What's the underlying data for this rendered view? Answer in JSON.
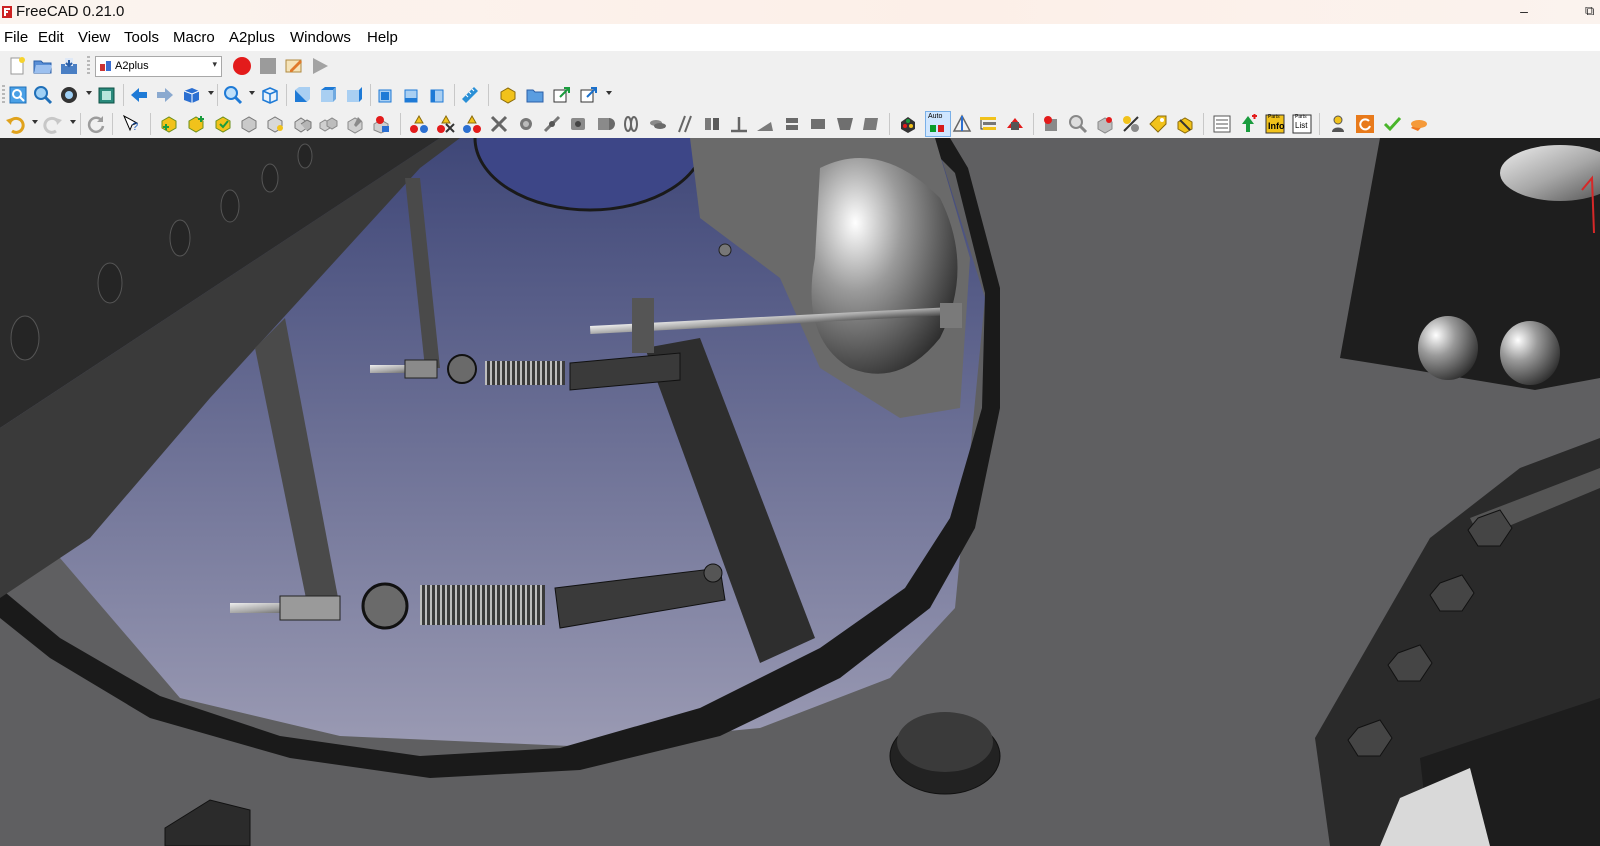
{
  "window": {
    "title": "FreeCAD 0.21.0",
    "minimize_glyph": "–",
    "restore_glyph": "⧉"
  },
  "menu": {
    "items": [
      "File",
      "Edit",
      "View",
      "Tools",
      "Macro",
      "A2plus",
      "Windows",
      "Help"
    ]
  },
  "workbench_selector": {
    "value": "A2plus",
    "icon": "a2plus-workbench-icon"
  },
  "toolbar_badges": {
    "auto_label": "Auto",
    "parts_info_label": "Info",
    "parts_info_caption": "Parts",
    "parts_list_label": "List",
    "parts_list_caption": "Parts"
  },
  "colors": {
    "viewport_background": "#5f5f61",
    "sky_top": "#3f4778",
    "sky_bottom": "#9a9ab3",
    "record_red": "#e31b1b",
    "nav_blue": "#1e7ad6",
    "assembly_yellow": "#f1c21b"
  }
}
